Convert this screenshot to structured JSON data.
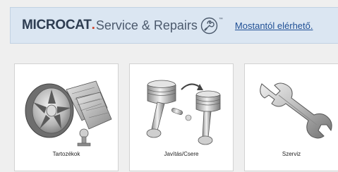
{
  "banner": {
    "brand_bold": "MICROCAT",
    "brand_dot": ".",
    "brand_light": "Service & Repairs",
    "trademark": "™",
    "wrench_icon": "wrench-circle-icon",
    "link_text": "Mostantól elérhető."
  },
  "tiles": [
    {
      "label": "Tartozékok",
      "icon": "accessories-wheel-mats-icon"
    },
    {
      "label": "Javítás/Csere",
      "icon": "piston-repair-icon"
    },
    {
      "label": "Szerviz",
      "icon": "wrench-service-icon"
    }
  ],
  "colors": {
    "banner_bg": "#dbe6f2",
    "brand_text": "#2e3d52",
    "brand_dot": "#d0452e",
    "link": "#1f4f95",
    "page_bg": "#efefef"
  }
}
